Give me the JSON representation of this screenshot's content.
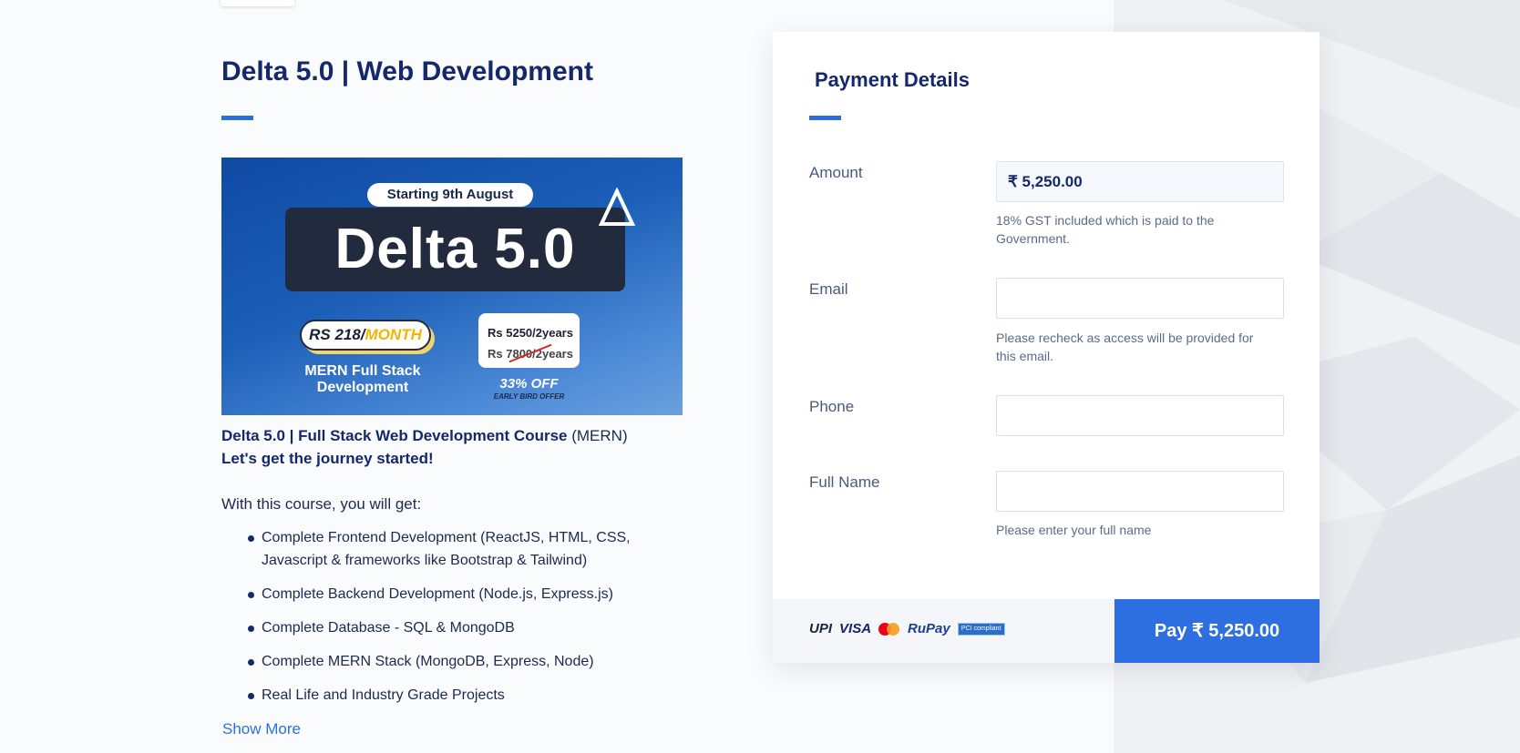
{
  "course": {
    "title": "Delta 5.0 | Web Development",
    "banner": {
      "start": "Starting 9th August",
      "name": "Delta 5.0",
      "monthly_prefix": "RS 218/",
      "monthly_suffix": "MONTH",
      "track_line1": "MERN Full Stack",
      "track_line2": "Development",
      "price_new": "Rs 5250/2years",
      "price_old": "Rs 7800/2years",
      "discount": "33% OFF",
      "offer": "EARLY BIRD OFFER"
    },
    "headline_bold": "Delta 5.0 | Full Stack Web Development Course",
    "headline_rest": " (MERN)",
    "tagline": "Let's get the journey started!",
    "intro": "With this course, you will get:",
    "features": [
      "Complete Frontend Development (ReactJS, HTML, CSS, Javascript & frameworks like Bootstrap & Tailwind)",
      "Complete Backend Development (Node.js, Express.js)",
      "Complete Database - SQL & MongoDB",
      "Complete MERN Stack (MongoDB, Express, Node)",
      "Real Life and Industry Grade Projects"
    ],
    "show_more": "Show More"
  },
  "payment": {
    "title": "Payment Details",
    "amount_label": "Amount",
    "amount_value": "₹ 5,250.00",
    "amount_help": "18% GST included which is paid to the Government.",
    "email_label": "Email",
    "email_value": "",
    "email_help": "Please recheck as access will be provided for this email.",
    "phone_label": "Phone",
    "phone_value": "",
    "fullname_label": "Full Name",
    "fullname_value": "",
    "fullname_help": "Please enter your full name",
    "methods": [
      "UPI",
      "VISA",
      "RuPay",
      "PCI compliant"
    ],
    "pay_button": "Pay  ₹ 5,250.00"
  },
  "colors": {
    "accent": "#2b6fdc",
    "title": "#14286b",
    "pay_button": "#2d6ee0"
  }
}
